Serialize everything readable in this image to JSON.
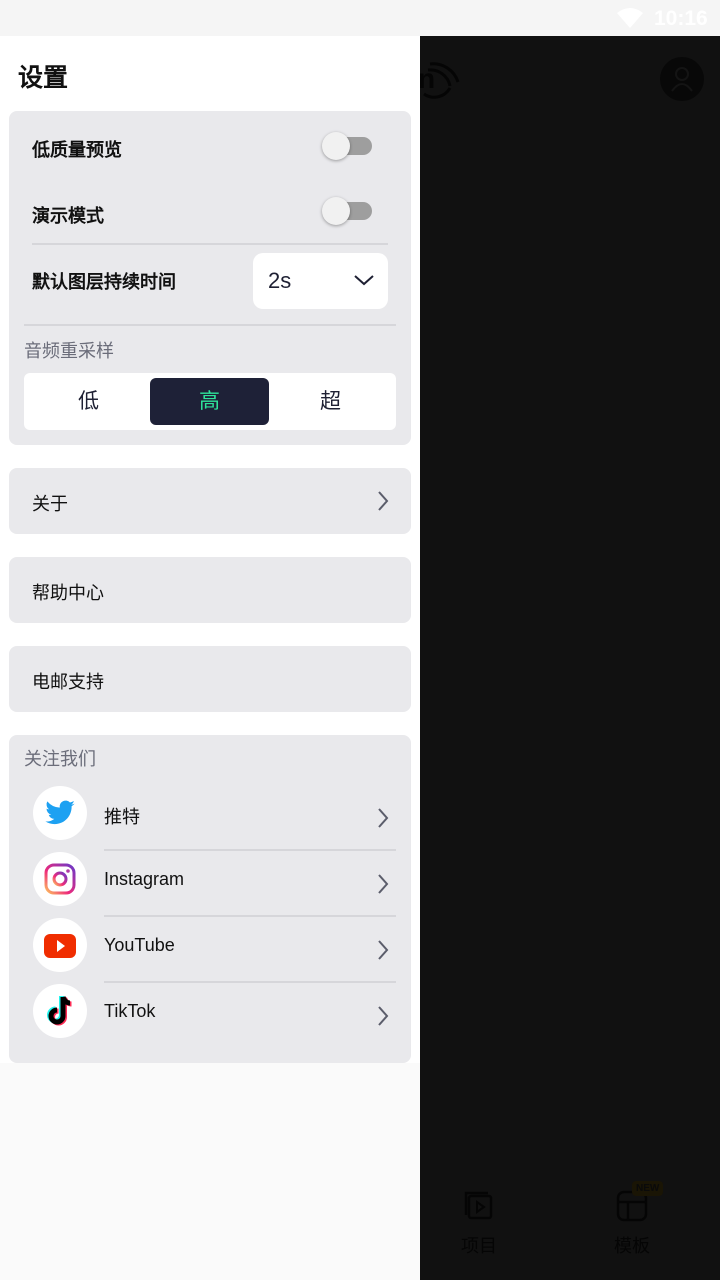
{
  "status_bar": {
    "time": "10:16",
    "wifi_icon": "wifi-icon"
  },
  "background": {
    "bottom_nav": [
      {
        "label": "项目",
        "icon": "projects-icon"
      },
      {
        "label": "模板",
        "icon": "template-icon",
        "badge": "NEW"
      }
    ]
  },
  "drawer": {
    "title": "设置",
    "settings": {
      "low_quality_preview": {
        "label": "低质量预览",
        "on": false
      },
      "demo_mode": {
        "label": "演示模式",
        "on": false
      },
      "default_layer_duration": {
        "label": "默认图层持续时间",
        "value": "2s"
      },
      "audio_resampling": {
        "label": "音频重采样",
        "options": [
          "低",
          "高",
          "超"
        ],
        "selected": "高"
      }
    },
    "links": [
      {
        "label": "关于"
      },
      {
        "label": "帮助中心"
      },
      {
        "label": "电邮支持"
      }
    ],
    "follow": {
      "title": "关注我们",
      "items": [
        {
          "label": "推特",
          "icon": "twitter-icon"
        },
        {
          "label": "Instagram",
          "icon": "instagram-icon"
        },
        {
          "label": "YouTube",
          "icon": "youtube-icon"
        },
        {
          "label": "TikTok",
          "icon": "tiktok-icon"
        }
      ]
    }
  },
  "colors": {
    "accent": "#2fe39a",
    "selected_bg": "#1e2137",
    "card_bg": "#e9e9ec"
  }
}
